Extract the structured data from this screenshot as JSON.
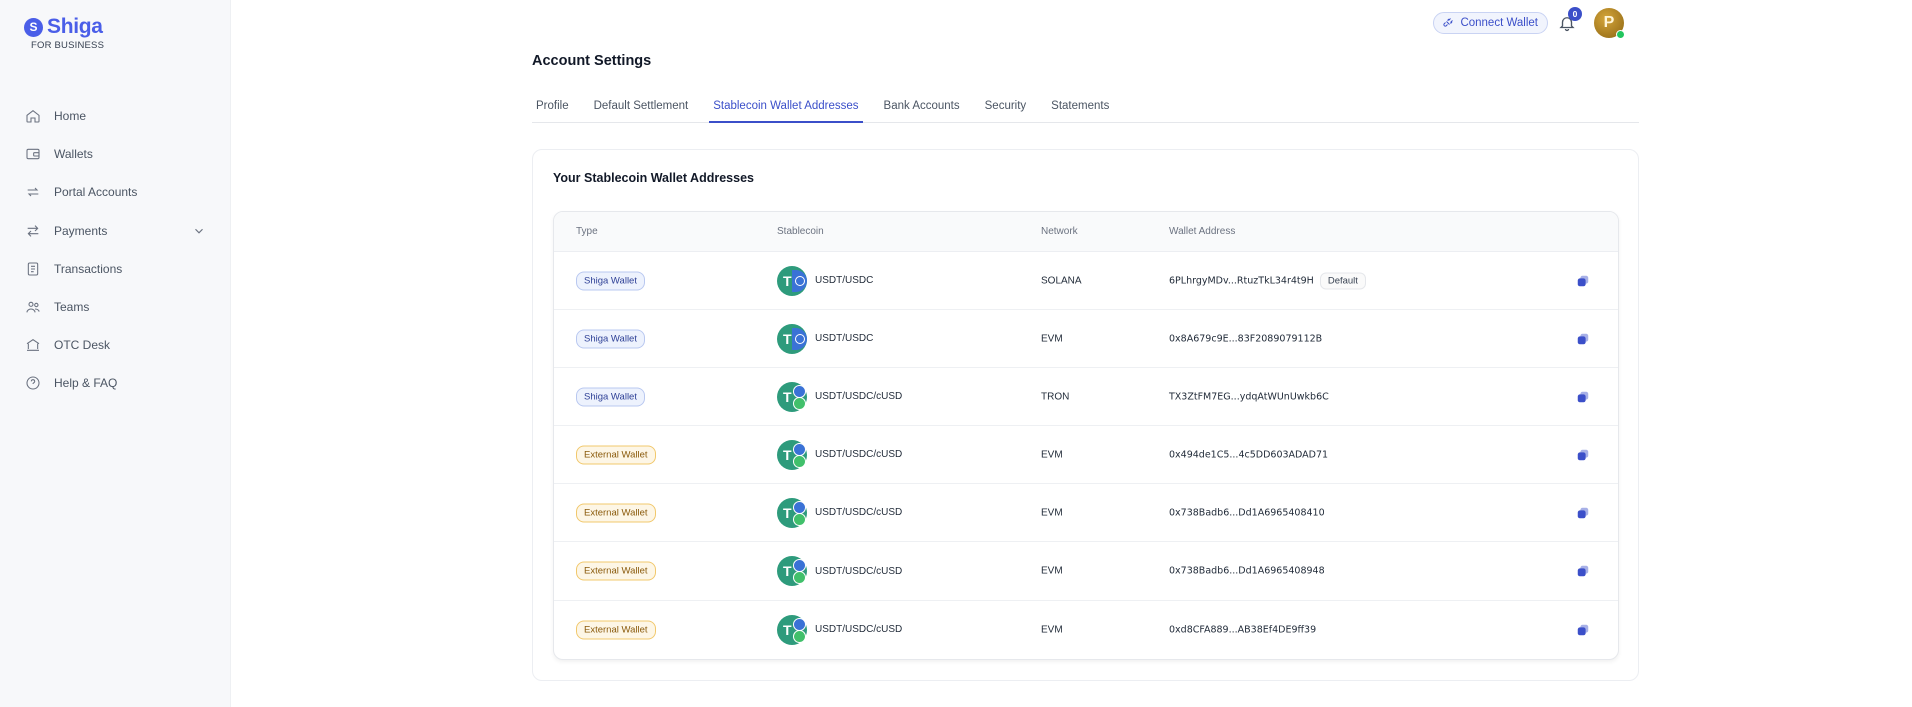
{
  "brand": {
    "name": "Shiga",
    "sub": "FOR BUSINESS",
    "mark": "S"
  },
  "sidebar": {
    "items": [
      {
        "label": "Home",
        "icon": "home-icon"
      },
      {
        "label": "Wallets",
        "icon": "wallet-icon"
      },
      {
        "label": "Portal Accounts",
        "icon": "portal-icon"
      },
      {
        "label": "Payments",
        "icon": "arrows-icon",
        "has_chevron": true
      },
      {
        "label": "Transactions",
        "icon": "document-icon"
      },
      {
        "label": "Teams",
        "icon": "users-icon"
      },
      {
        "label": "OTC Desk",
        "icon": "bank-icon"
      },
      {
        "label": "Help & FAQ",
        "icon": "help-icon"
      }
    ]
  },
  "topbar": {
    "connect_label": "Connect Wallet",
    "notification_count": "0",
    "avatar_initial": "P"
  },
  "page": {
    "title": "Account Settings"
  },
  "tabs": [
    {
      "label": "Profile",
      "active": false
    },
    {
      "label": "Default Settlement",
      "active": false
    },
    {
      "label": "Stablecoin Wallet Addresses",
      "active": true
    },
    {
      "label": "Bank Accounts",
      "active": false
    },
    {
      "label": "Security",
      "active": false
    },
    {
      "label": "Statements",
      "active": false
    }
  ],
  "card": {
    "title": "Your Stablecoin Wallet Addresses"
  },
  "table": {
    "headers": {
      "type": "Type",
      "stablecoin": "Stablecoin",
      "network": "Network",
      "address": "Wallet Address"
    },
    "rows": [
      {
        "type": "Shiga Wallet",
        "kind": "shiga",
        "coin": "USDT/USDC",
        "icon": "usdt-usdc",
        "network": "SOLANA",
        "address": "6PLhrgyMDv...RtuzTkL34r4t9H",
        "default": "Default"
      },
      {
        "type": "Shiga Wallet",
        "kind": "shiga",
        "coin": "USDT/USDC",
        "icon": "usdt-usdc",
        "network": "EVM",
        "address": "0x8A679c9E...83F2089079112B",
        "default": ""
      },
      {
        "type": "Shiga Wallet",
        "kind": "shiga",
        "coin": "USDT/USDC/cUSD",
        "icon": "usdt-usdc-cusd",
        "network": "TRON",
        "address": "TX3ZtFM7EG...ydqAtWUnUwkb6C",
        "default": ""
      },
      {
        "type": "External Wallet",
        "kind": "external",
        "coin": "USDT/USDC/cUSD",
        "icon": "usdt-usdc-cusd",
        "network": "EVM",
        "address": "0x494de1C5...4c5DD603ADAD71",
        "default": ""
      },
      {
        "type": "External Wallet",
        "kind": "external",
        "coin": "USDT/USDC/cUSD",
        "icon": "usdt-usdc-cusd",
        "network": "EVM",
        "address": "0x738Badb6...Dd1A6965408410",
        "default": ""
      },
      {
        "type": "External Wallet",
        "kind": "external",
        "coin": "USDT/USDC/cUSD",
        "icon": "usdt-usdc-cusd",
        "network": "EVM",
        "address": "0x738Badb6...Dd1A6965408948",
        "default": ""
      },
      {
        "type": "External Wallet",
        "kind": "external",
        "coin": "USDT/USDC/cUSD",
        "icon": "usdt-usdc-cusd",
        "network": "EVM",
        "address": "0xd8CFA889...AB38Ef4DE9ff39",
        "default": ""
      }
    ]
  },
  "colors": {
    "accent": "#3b4fc9",
    "brand": "#4a5ee8",
    "copy_icon": "#3b4fc9"
  }
}
